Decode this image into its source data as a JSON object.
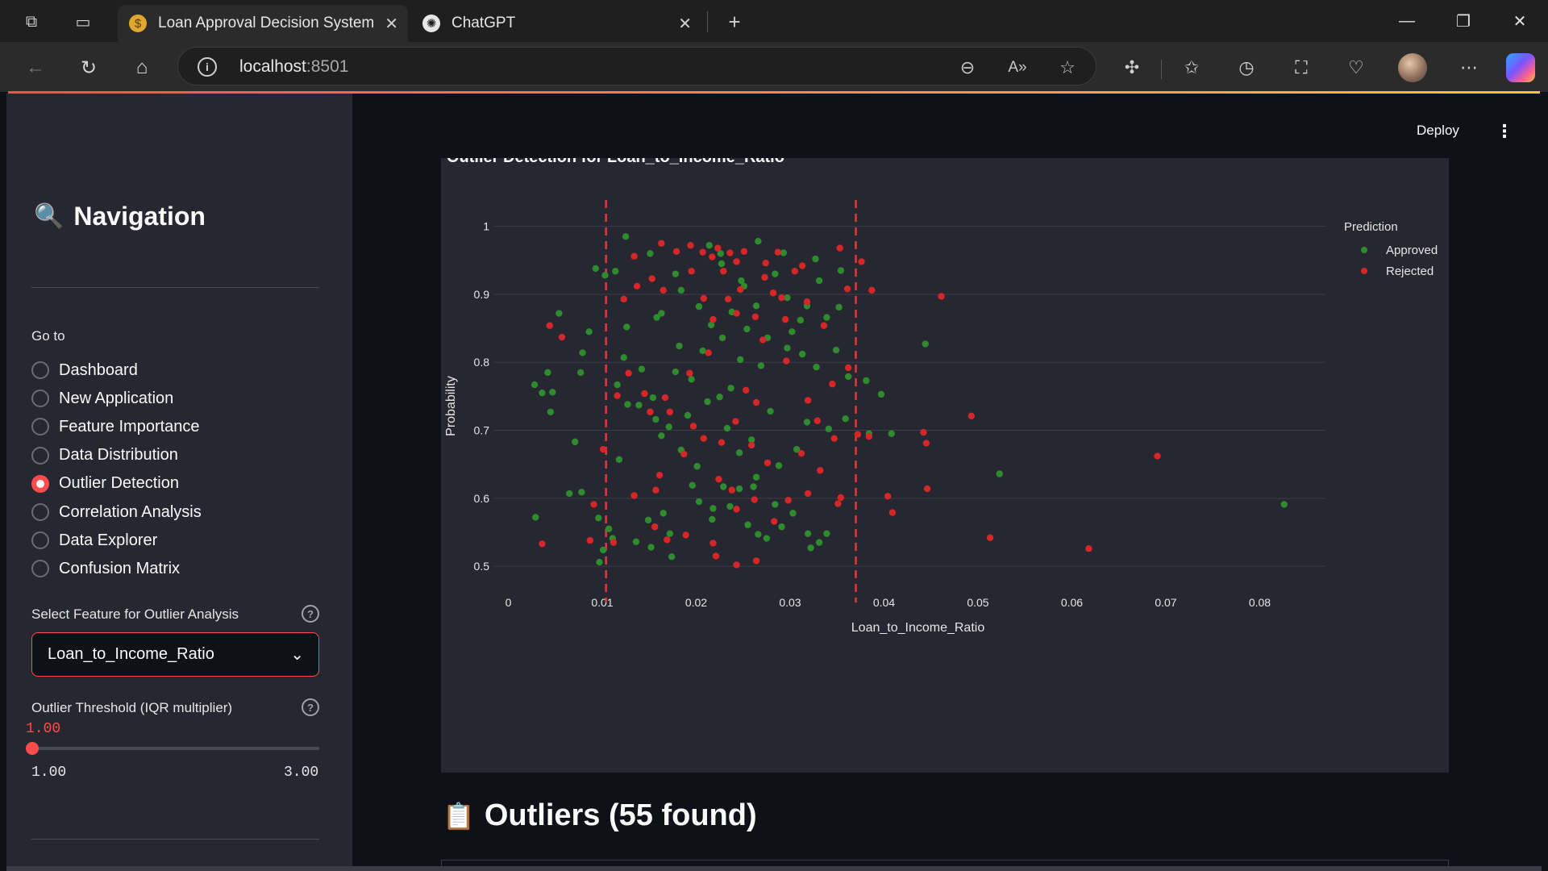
{
  "browser": {
    "tabs": [
      {
        "title": "Loan Approval Decision System",
        "active": true,
        "favicon": "moneybag-icon"
      },
      {
        "title": "ChatGPT",
        "active": false,
        "favicon": "chatgpt-icon"
      }
    ],
    "url_host": "localhost",
    "url_port": ":8501"
  },
  "sidebar": {
    "title": "Navigation",
    "title_icon": "🔍",
    "goto_label": "Go to",
    "pages": [
      {
        "label": "Dashboard",
        "selected": false
      },
      {
        "label": "New Application",
        "selected": false
      },
      {
        "label": "Feature Importance",
        "selected": false
      },
      {
        "label": "Data Distribution",
        "selected": false
      },
      {
        "label": "Outlier Detection",
        "selected": true
      },
      {
        "label": "Correlation Analysis",
        "selected": false
      },
      {
        "label": "Data Explorer",
        "selected": false
      },
      {
        "label": "Confusion Matrix",
        "selected": false
      }
    ],
    "feature_select": {
      "label": "Select Feature for Outlier Analysis",
      "value": "Loan_to_Income_Ratio"
    },
    "threshold_slider": {
      "label": "Outlier Threshold (IQR multiplier)",
      "value": "1.00",
      "min": "1.00",
      "max": "3.00",
      "fraction": 0
    }
  },
  "header": {
    "deploy_label": "Deploy",
    "menu_icon": "⋮"
  },
  "plot": {
    "title": "Outlier Detection for Loan_to_Income_Ratio"
  },
  "chart_data": {
    "type": "scatter",
    "title": "Outlier Detection for Loan_to_Income_Ratio",
    "xlabel": "Loan_to_Income_Ratio",
    "ylabel": "Probability",
    "xlim": [
      -0.0015,
      0.087
    ],
    "ylim": [
      0.48,
      1.015
    ],
    "xticks": [
      "0",
      "0.01",
      "0.02",
      "0.03",
      "0.04",
      "0.05",
      "0.06",
      "0.07",
      "0.08"
    ],
    "xtick_values": [
      0,
      0.01,
      0.02,
      0.03,
      0.04,
      0.05,
      0.06,
      0.07,
      0.08
    ],
    "yticks": [
      "0.5",
      "0.6",
      "0.7",
      "0.8",
      "0.9",
      "1"
    ],
    "ytick_values": [
      0.5,
      0.6,
      0.7,
      0.8,
      0.9,
      1.0
    ],
    "grid": true,
    "legend": {
      "title": "Prediction",
      "placement": "top-right"
    },
    "outlier_bounds": [
      0.0104,
      0.037
    ],
    "series": [
      {
        "name": "Approved",
        "color": "#2e8b2e",
        "points": [
          [
            0.0125,
            0.985
          ],
          [
            0.0178,
            0.93
          ],
          [
            0.0151,
            0.96
          ],
          [
            0.0227,
            0.945
          ],
          [
            0.0284,
            0.93
          ],
          [
            0.0331,
            0.92
          ],
          [
            0.0266,
            0.978
          ],
          [
            0.0214,
            0.972
          ],
          [
            0.0248,
            0.92
          ],
          [
            0.0293,
            0.961
          ],
          [
            0.0327,
            0.952
          ],
          [
            0.0354,
            0.935
          ],
          [
            0.0184,
            0.906
          ],
          [
            0.0203,
            0.882
          ],
          [
            0.0238,
            0.874
          ],
          [
            0.0297,
            0.895
          ],
          [
            0.0311,
            0.862
          ],
          [
            0.0352,
            0.881
          ],
          [
            0.0158,
            0.866
          ],
          [
            0.0126,
            0.852
          ],
          [
            0.0103,
            0.928
          ],
          [
            0.0114,
            0.934
          ],
          [
            0.0093,
            0.938
          ],
          [
            0.0054,
            0.872
          ],
          [
            0.0079,
            0.814
          ],
          [
            0.0086,
            0.845
          ],
          [
            0.0123,
            0.807
          ],
          [
            0.0077,
            0.785
          ],
          [
            0.0042,
            0.785
          ],
          [
            0.0036,
            0.755
          ],
          [
            0.0047,
            0.756
          ],
          [
            0.0045,
            0.727
          ],
          [
            0.0028,
            0.767
          ],
          [
            0.0071,
            0.683
          ],
          [
            0.0078,
            0.609
          ],
          [
            0.0065,
            0.607
          ],
          [
            0.0029,
            0.572
          ],
          [
            0.0096,
            0.571
          ],
          [
            0.0101,
            0.524
          ],
          [
            0.0097,
            0.506
          ],
          [
            0.0142,
            0.79
          ],
          [
            0.0154,
            0.748
          ],
          [
            0.0178,
            0.786
          ],
          [
            0.0195,
            0.775
          ],
          [
            0.0207,
            0.817
          ],
          [
            0.0247,
            0.804
          ],
          [
            0.0269,
            0.795
          ],
          [
            0.0297,
            0.821
          ],
          [
            0.0313,
            0.812
          ],
          [
            0.0328,
            0.793
          ],
          [
            0.0349,
            0.818
          ],
          [
            0.0362,
            0.779
          ],
          [
            0.0381,
            0.773
          ],
          [
            0.0397,
            0.753
          ],
          [
            0.0225,
            0.749
          ],
          [
            0.0233,
            0.703
          ],
          [
            0.0246,
            0.667
          ],
          [
            0.0259,
            0.686
          ],
          [
            0.0264,
            0.631
          ],
          [
            0.0288,
            0.648
          ],
          [
            0.0307,
            0.672
          ],
          [
            0.0318,
            0.712
          ],
          [
            0.0341,
            0.702
          ],
          [
            0.0359,
            0.717
          ],
          [
            0.0201,
            0.647
          ],
          [
            0.0184,
            0.671
          ],
          [
            0.0171,
            0.705
          ],
          [
            0.0157,
            0.716
          ],
          [
            0.0163,
            0.692
          ],
          [
            0.0139,
            0.737
          ],
          [
            0.0127,
            0.738
          ],
          [
            0.0116,
            0.767
          ],
          [
            0.0196,
            0.619
          ],
          [
            0.0203,
            0.595
          ],
          [
            0.0218,
            0.585
          ],
          [
            0.0236,
            0.588
          ],
          [
            0.0255,
            0.561
          ],
          [
            0.0266,
            0.547
          ],
          [
            0.0275,
            0.541
          ],
          [
            0.0291,
            0.558
          ],
          [
            0.0303,
            0.578
          ],
          [
            0.0319,
            0.548
          ],
          [
            0.0331,
            0.535
          ],
          [
            0.0322,
            0.527
          ],
          [
            0.0172,
            0.548
          ],
          [
            0.0165,
            0.578
          ],
          [
            0.0149,
            0.568
          ],
          [
            0.0174,
            0.514
          ],
          [
            0.0152,
            0.528
          ],
          [
            0.0136,
            0.536
          ],
          [
            0.0118,
            0.657
          ],
          [
            0.0111,
            0.541
          ],
          [
            0.0107,
            0.555
          ],
          [
            0.0246,
            0.614
          ],
          [
            0.0229,
            0.617
          ],
          [
            0.0217,
            0.569
          ],
          [
            0.0261,
            0.617
          ],
          [
            0.0284,
            0.591
          ],
          [
            0.0339,
            0.548
          ],
          [
            0.0384,
            0.695
          ],
          [
            0.0408,
            0.695
          ],
          [
            0.0444,
            0.827
          ],
          [
            0.0523,
            0.636
          ],
          [
            0.0826,
            0.591
          ],
          [
            0.0182,
            0.824
          ],
          [
            0.0163,
            0.872
          ],
          [
            0.0237,
            0.762
          ],
          [
            0.0212,
            0.742
          ],
          [
            0.0191,
            0.722
          ],
          [
            0.0279,
            0.728
          ],
          [
            0.0216,
            0.855
          ],
          [
            0.0228,
            0.836
          ],
          [
            0.0254,
            0.849
          ],
          [
            0.0276,
            0.836
          ],
          [
            0.0302,
            0.845
          ],
          [
            0.0318,
            0.883
          ],
          [
            0.0339,
            0.866
          ],
          [
            0.0264,
            0.883
          ],
          [
            0.0251,
            0.912
          ],
          [
            0.0226,
            0.96
          ]
        ]
      },
      {
        "name": "Rejected",
        "color": "#d62728",
        "points": [
          [
            0.0134,
            0.956
          ],
          [
            0.0163,
            0.975
          ],
          [
            0.0179,
            0.963
          ],
          [
            0.0194,
            0.972
          ],
          [
            0.0207,
            0.962
          ],
          [
            0.0217,
            0.955
          ],
          [
            0.0223,
            0.968
          ],
          [
            0.0236,
            0.961
          ],
          [
            0.0243,
            0.948
          ],
          [
            0.0251,
            0.963
          ],
          [
            0.0273,
            0.925
          ],
          [
            0.0282,
            0.902
          ],
          [
            0.0291,
            0.895
          ],
          [
            0.0305,
            0.934
          ],
          [
            0.0313,
            0.942
          ],
          [
            0.0353,
            0.968
          ],
          [
            0.0376,
            0.948
          ],
          [
            0.0387,
            0.906
          ],
          [
            0.0461,
            0.897
          ],
          [
            0.0153,
            0.923
          ],
          [
            0.0165,
            0.906
          ],
          [
            0.0123,
            0.893
          ],
          [
            0.0137,
            0.912
          ],
          [
            0.0044,
            0.854
          ],
          [
            0.0057,
            0.837
          ],
          [
            0.0116,
            0.751
          ],
          [
            0.0128,
            0.784
          ],
          [
            0.0145,
            0.754
          ],
          [
            0.0208,
            0.894
          ],
          [
            0.0218,
            0.863
          ],
          [
            0.0234,
            0.893
          ],
          [
            0.0243,
            0.872
          ],
          [
            0.0263,
            0.867
          ],
          [
            0.0271,
            0.833
          ],
          [
            0.0295,
            0.863
          ],
          [
            0.0336,
            0.854
          ],
          [
            0.0362,
            0.792
          ],
          [
            0.0345,
            0.768
          ],
          [
            0.0296,
            0.802
          ],
          [
            0.0213,
            0.814
          ],
          [
            0.0193,
            0.784
          ],
          [
            0.0167,
            0.748
          ],
          [
            0.0253,
            0.759
          ],
          [
            0.0264,
            0.741
          ],
          [
            0.0242,
            0.713
          ],
          [
            0.0227,
            0.682
          ],
          [
            0.0197,
            0.706
          ],
          [
            0.0172,
            0.727
          ],
          [
            0.0151,
            0.727
          ],
          [
            0.0319,
            0.744
          ],
          [
            0.0329,
            0.714
          ],
          [
            0.0347,
            0.688
          ],
          [
            0.0372,
            0.694
          ],
          [
            0.0384,
            0.691
          ],
          [
            0.0442,
            0.697
          ],
          [
            0.0493,
            0.721
          ],
          [
            0.0691,
            0.662
          ],
          [
            0.0445,
            0.681
          ],
          [
            0.0101,
            0.672
          ],
          [
            0.0224,
            0.628
          ],
          [
            0.0243,
            0.584
          ],
          [
            0.0238,
            0.612
          ],
          [
            0.0262,
            0.598
          ],
          [
            0.0283,
            0.566
          ],
          [
            0.0298,
            0.597
          ],
          [
            0.0319,
            0.607
          ],
          [
            0.0332,
            0.641
          ],
          [
            0.0351,
            0.592
          ],
          [
            0.0404,
            0.603
          ],
          [
            0.0409,
            0.579
          ],
          [
            0.0446,
            0.614
          ],
          [
            0.0513,
            0.542
          ],
          [
            0.0618,
            0.526
          ],
          [
            0.0221,
            0.515
          ],
          [
            0.0264,
            0.508
          ],
          [
            0.0243,
            0.502
          ],
          [
            0.0218,
            0.534
          ],
          [
            0.0189,
            0.546
          ],
          [
            0.0169,
            0.539
          ],
          [
            0.0156,
            0.558
          ],
          [
            0.0157,
            0.612
          ],
          [
            0.0161,
            0.634
          ],
          [
            0.0134,
            0.604
          ],
          [
            0.0112,
            0.535
          ],
          [
            0.0087,
            0.538
          ],
          [
            0.0036,
            0.533
          ],
          [
            0.0091,
            0.591
          ],
          [
            0.0187,
            0.665
          ],
          [
            0.0208,
            0.688
          ],
          [
            0.0259,
            0.678
          ],
          [
            0.0276,
            0.652
          ],
          [
            0.0312,
            0.666
          ],
          [
            0.0354,
            0.601
          ],
          [
            0.0361,
            0.908
          ],
          [
            0.0195,
            0.934
          ],
          [
            0.0274,
            0.946
          ],
          [
            0.0287,
            0.962
          ],
          [
            0.0318,
            0.889
          ],
          [
            0.0247,
            0.907
          ],
          [
            0.0229,
            0.934
          ]
        ]
      }
    ]
  },
  "outliers_section": {
    "icon": "📋",
    "title": "Outliers (55 found)"
  }
}
